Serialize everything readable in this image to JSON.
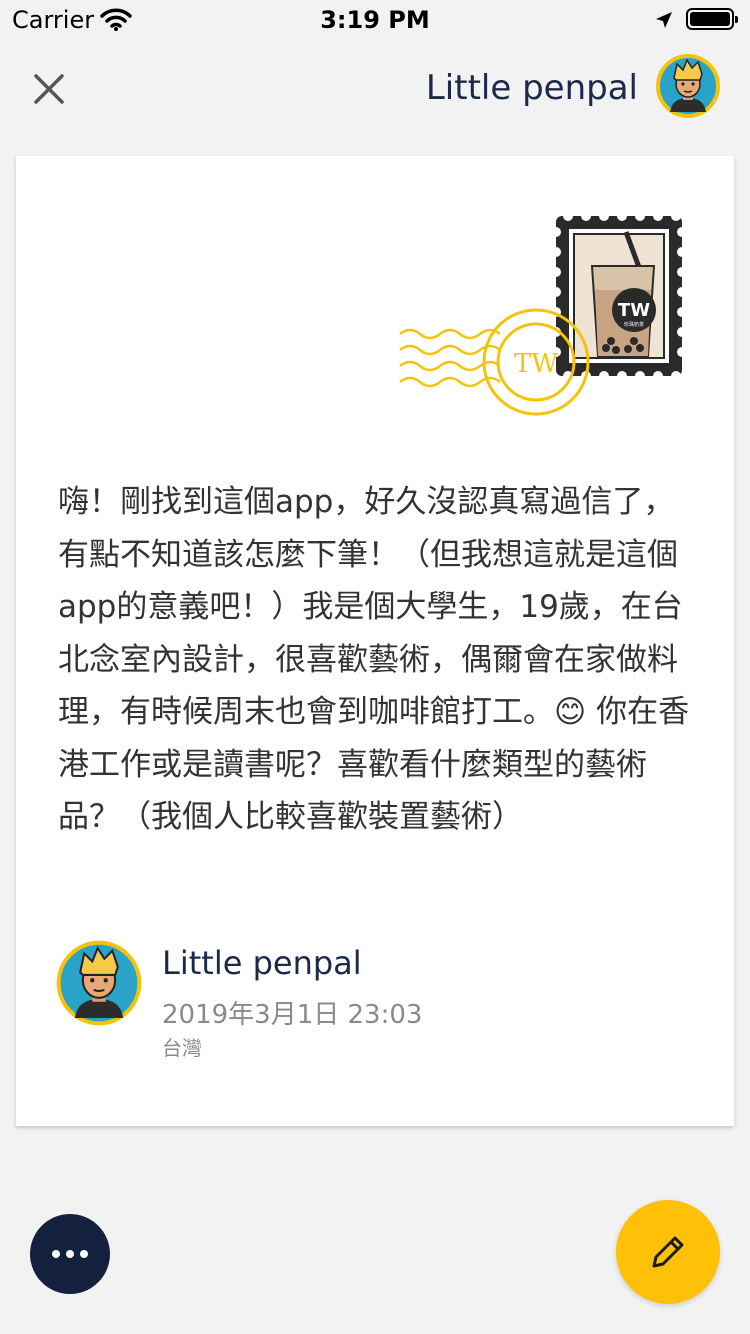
{
  "status_bar": {
    "carrier": "Carrier",
    "time": "3:19 PM",
    "icons": [
      "wifi-icon",
      "location-arrow-icon",
      "battery-icon"
    ]
  },
  "header": {
    "close_icon": "close-icon",
    "name": "Little penpal",
    "avatar_icon": "avatar-boy-blond"
  },
  "letter": {
    "stamp": {
      "label": "TW",
      "sub_label": "珍珠奶茶",
      "postmark_label": "TW"
    },
    "body": "嗨！剛找到這個app，好久沒認真寫過信了，有點不知道該怎麼下筆！（但我想這就是這個app的意義吧！）我是個大學生，19歲，在台北念室內設計，很喜歡藝術，偶爾會在家做料理，有時候周末也會到咖啡館打工。😊 你在香港工作或是讀書呢？喜歡看什麼類型的藝術品？（我個人比較喜歡裝置藝術）",
    "author": {
      "name": "Little penpal",
      "date": "2019年3月1日 23:03",
      "location": "台灣"
    }
  },
  "actions": {
    "more_icon": "more-dots-icon",
    "compose_icon": "pencil-icon"
  },
  "colors": {
    "navy": "#13213f",
    "accent_yellow": "#ffc107",
    "avatar_ring": "#f5c20c",
    "avatar_bg": "#2aa3c9",
    "postmark": "#f5c20c"
  }
}
